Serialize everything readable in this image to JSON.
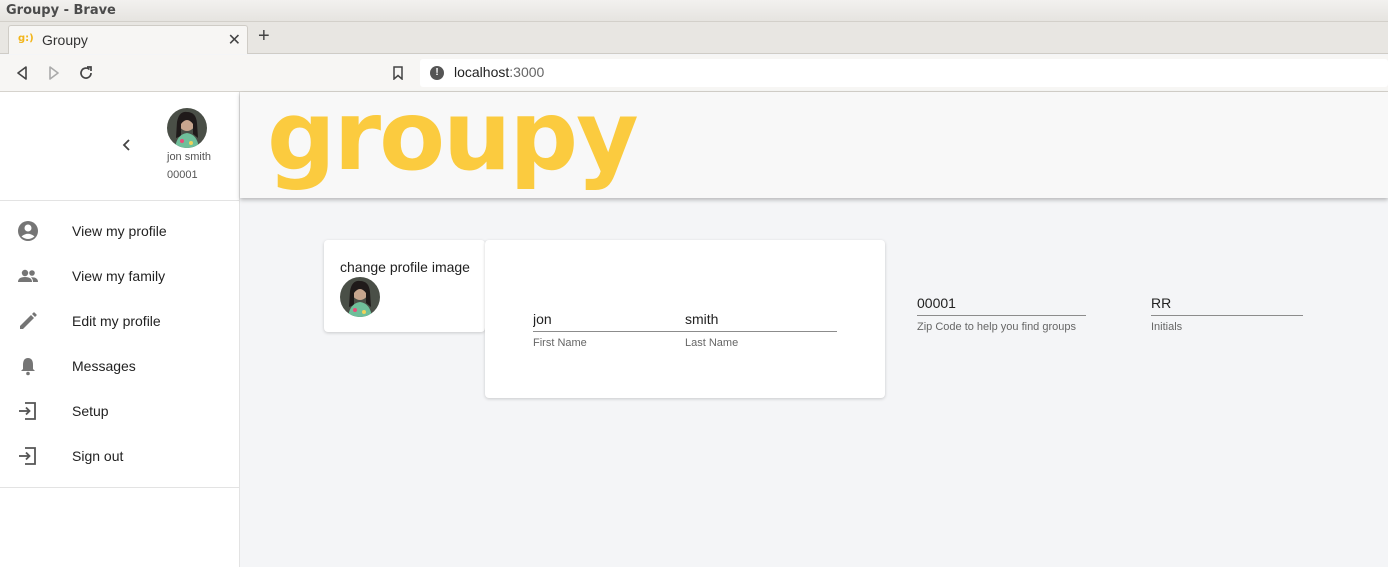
{
  "window": {
    "title": "Groupy - Brave"
  },
  "tab": {
    "title": "Groupy",
    "favicon": "g:)"
  },
  "nav": {
    "url_host": "localhost",
    "url_port": ":3000"
  },
  "sidebar": {
    "user_name": "jon smith",
    "user_id": "00001",
    "items": [
      {
        "label": "View my profile",
        "icon": "account-circle-icon"
      },
      {
        "label": "View my family",
        "icon": "people-icon"
      },
      {
        "label": "Edit my profile",
        "icon": "pencil-icon"
      },
      {
        "label": "Messages",
        "icon": "bell-icon"
      },
      {
        "label": "Setup",
        "icon": "login-icon"
      },
      {
        "label": "Sign out",
        "icon": "login-icon"
      }
    ]
  },
  "appbar": {
    "logo_text": "groupy"
  },
  "profile_image_card": {
    "caption": "change profile image"
  },
  "form": {
    "first_name": {
      "value": "jon",
      "label": "First Name"
    },
    "last_name": {
      "value": "smith",
      "label": "Last Name"
    },
    "zip": {
      "value": "00001",
      "label": "Zip Code to help you find groups"
    },
    "initials": {
      "value": "RR",
      "label": "Initials"
    }
  },
  "colors": {
    "brand": "#fbcb3f",
    "background": "#f4f5f7"
  }
}
